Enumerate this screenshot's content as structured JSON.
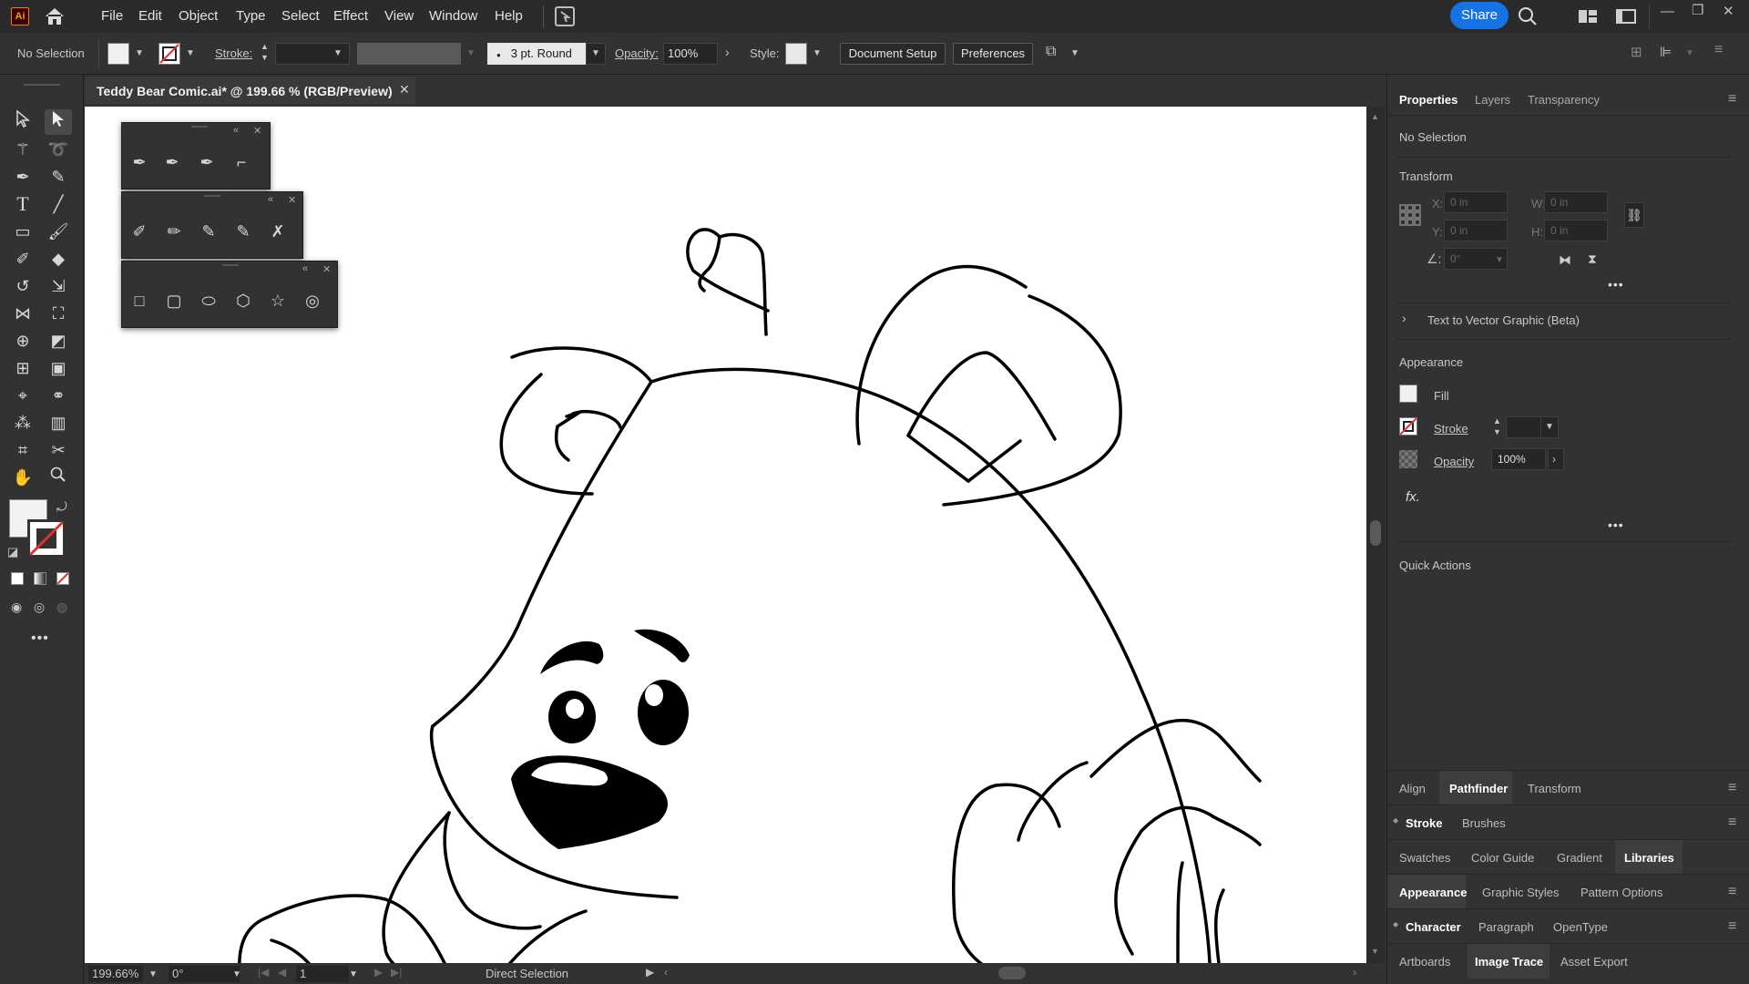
{
  "app": {
    "logo": "Ai"
  },
  "menu": [
    "File",
    "Edit",
    "Object",
    "Type",
    "Select",
    "Effect",
    "View",
    "Window",
    "Help"
  ],
  "share_label": "Share",
  "controlbar": {
    "selection": "No Selection",
    "stroke_label": "Stroke:",
    "brush": "3 pt. Round",
    "opacity_label": "Opacity:",
    "opacity_value": "100%",
    "style_label": "Style:",
    "document_setup": "Document Setup",
    "preferences": "Preferences"
  },
  "document": {
    "tab_title": "Teddy Bear Comic.ai* @ 199.66 % (RGB/Preview)"
  },
  "statusbar": {
    "zoom": "199.66%",
    "rotation": "0°",
    "artboard": "1",
    "tool": "Direct Selection"
  },
  "properties": {
    "tabs": [
      "Properties",
      "Layers",
      "Transparency"
    ],
    "selection": "No Selection",
    "transform_title": "Transform",
    "x_label": "X:",
    "y_label": "Y:",
    "w_label": "W:",
    "h_label": "H:",
    "x_value": "0 in",
    "y_value": "0 in",
    "w_value": "0 in",
    "h_value": "0 in",
    "angle_value": "0°",
    "text_to_vector": "Text to Vector Graphic (Beta)",
    "appearance_title": "Appearance",
    "fill_label": "Fill",
    "stroke_label": "Stroke",
    "opacity_label": "Opacity",
    "opacity_value": "100%",
    "fx_label": "fx.",
    "quick_actions": "Quick Actions"
  },
  "panel_stacks": [
    {
      "tabs": [
        "Align",
        "Pathfinder",
        "Transform"
      ],
      "active": 1
    },
    {
      "tabs": [
        "Stroke",
        "Brushes"
      ],
      "active": 0
    },
    {
      "tabs": [
        "Swatches",
        "Color Guide",
        "Gradient",
        "Libraries"
      ],
      "active": 3
    },
    {
      "tabs": [
        "Appearance",
        "Graphic Styles",
        "Pattern Options"
      ],
      "active": 0
    },
    {
      "tabs": [
        "Character",
        "Paragraph",
        "OpenType"
      ],
      "active": 0
    },
    {
      "tabs": [
        "Artboards",
        "Image Trace",
        "Asset Export"
      ],
      "active": 1
    }
  ],
  "colors": {
    "accent": "#1473e6",
    "canvas": "#ffffff",
    "ui_bg": "#323232",
    "none_red": "#e03030"
  },
  "icons": [
    "home-icon",
    "search-icon",
    "arrange-icon",
    "workspace-icon",
    "selection-tool-icon",
    "direct-selection-tool-icon",
    "pen-tool-icon",
    "type-tool-icon",
    "rectangle-tool-icon",
    "brush-tool-icon",
    "hand-tool-icon",
    "zoom-tool-icon",
    "link-icon",
    "flip-horizontal-icon",
    "flip-vertical-icon",
    "more-icon"
  ]
}
